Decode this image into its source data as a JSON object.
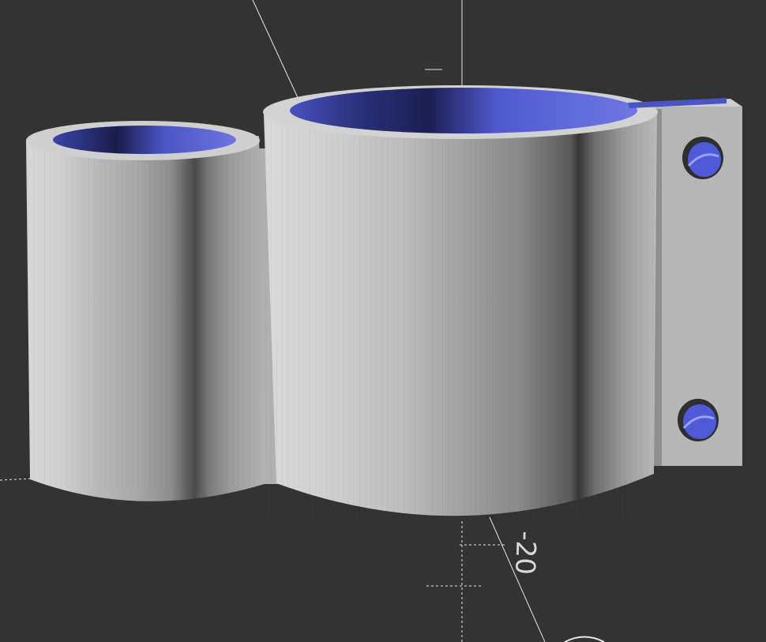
{
  "viewport": {
    "background_color": "#333333",
    "model_color": "#bdbdbd",
    "inner_surface_color": "#4b56c8",
    "axis_color": "#e0e0e0"
  },
  "scene": {
    "axis_tick_label": "-20",
    "objects": [
      "small-cylinder-tube",
      "large-cylinder-clamp",
      "mounting-flange",
      "screw-hole-top",
      "screw-hole-bottom"
    ]
  }
}
